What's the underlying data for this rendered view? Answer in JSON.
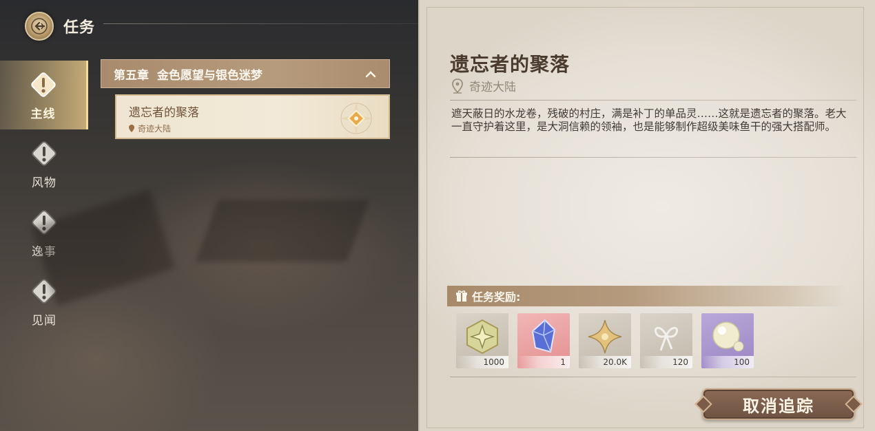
{
  "header": {
    "title": "任务",
    "back_icon": "back-emblem-icon"
  },
  "sidenav": {
    "items": [
      {
        "label": "主线",
        "icon": "quest-alert-icon",
        "active": true
      },
      {
        "label": "风物",
        "icon": "quest-alert-icon",
        "active": false
      },
      {
        "label": "逸事",
        "icon": "quest-alert-icon",
        "active": false
      },
      {
        "label": "见闻",
        "icon": "quest-alert-icon",
        "active": false
      }
    ]
  },
  "chapter": {
    "title": "第五章  金色愿望与银色迷梦",
    "expanded_icon": "chevron-up-icon",
    "quests": [
      {
        "name": "遗忘者的聚落",
        "location": "奇迹大陆",
        "marker_icon": "tracking-star-icon"
      }
    ]
  },
  "detail": {
    "title": "遗忘者的聚落",
    "location": "奇迹大陆",
    "description": "遮天蔽日的水龙卷，残破的村庄，满是补丁的单品灵……这就是遗忘者的聚落。老大一直守护着这里，是大洞信赖的领袖，也是能够制作超级美味鱼干的强大搭配师。",
    "rewards_label": "任务奖励:",
    "rewards": [
      {
        "icon": "star-badge-icon",
        "qty": "1000"
      },
      {
        "icon": "blue-crystal-icon",
        "qty": "1"
      },
      {
        "icon": "gold-star-coin-icon",
        "qty": "20.0K"
      },
      {
        "icon": "silver-ribbon-icon",
        "qty": "120"
      },
      {
        "icon": "pearl-icon",
        "qty": "100"
      }
    ],
    "cancel_label": "取消追踪"
  },
  "colors": {
    "active_tab": "#dcbd85",
    "chapter_header": "#b09272",
    "button": "#7a5c48",
    "parchment": "#ebe6dd"
  }
}
